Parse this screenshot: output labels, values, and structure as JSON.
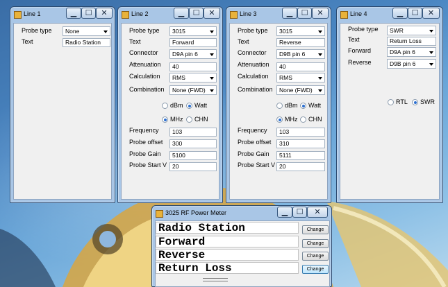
{
  "windows": [
    {
      "title": "Line 1",
      "probe_label": "Probe type",
      "probe_value": "None",
      "text_label": "Text",
      "text_value": "Radio Station"
    },
    {
      "title": "Line 2",
      "probe_label": "Probe type",
      "probe_value": "3015",
      "text_label": "Text",
      "text_value": "Forward",
      "connector_label": "Connector",
      "connector_value": "D9A pin 6",
      "attenuation_label": "Attenuation",
      "attenuation_value": "40",
      "calculation_label": "Calculation",
      "calculation_value": "RMS",
      "combination_label": "Combination",
      "combination_value": "None (FWD)",
      "dbm_label": "dBm",
      "watt_label": "Watt",
      "unit_selected": "Watt",
      "mhz_label": "MHz",
      "chn_label": "CHN",
      "freq_mode_selected": "MHz",
      "frequency_label": "Frequency",
      "frequency_value": "103",
      "probe_offset_label": "Probe offset",
      "probe_offset_value": "300",
      "probe_gain_label": "Probe Gain",
      "probe_gain_value": "5100",
      "probe_start_label": "Probe Start V",
      "probe_start_value": "20"
    },
    {
      "title": "Line 3",
      "probe_label": "Probe type",
      "probe_value": "3015",
      "text_label": "Text",
      "text_value": "Reverse",
      "connector_label": "Connector",
      "connector_value": "D9B pin 6",
      "attenuation_label": "Attenuation",
      "attenuation_value": "40",
      "calculation_label": "Calculation",
      "calculation_value": "RMS",
      "combination_label": "Combination",
      "combination_value": "None (FWD)",
      "dbm_label": "dBm",
      "watt_label": "Watt",
      "unit_selected": "Watt",
      "mhz_label": "MHz",
      "chn_label": "CHN",
      "freq_mode_selected": "MHz",
      "frequency_label": "Frequency",
      "frequency_value": "103",
      "probe_offset_label": "Probe offset",
      "probe_offset_value": "310",
      "probe_gain_label": "Probe Gain",
      "probe_gain_value": "5111",
      "probe_start_label": "Probe Start V",
      "probe_start_value": "20"
    },
    {
      "title": "Line 4",
      "probe_label": "Probe type",
      "probe_value": "SWR",
      "text_label": "Text",
      "text_value": "Return Loss",
      "forward_label": "Forward",
      "forward_value": "D9A pin 6",
      "reverse_label": "Reverse",
      "reverse_value": "D9B pin 6",
      "rtl_label": "RTL",
      "swr_label": "SWR",
      "mode_selected": "SWR"
    }
  ],
  "meter": {
    "title": "3025 RF Power Meter",
    "lines": [
      "Radio Station",
      "Forward",
      "Reverse",
      "Return Loss"
    ],
    "change_label": "Change",
    "highlighted_button": 4
  },
  "window_controls": {
    "minimize": "▁",
    "maximize": "☐",
    "close": "✕"
  },
  "colors": {
    "titlebar": "#a9c6e6",
    "client": "#f0f0f0",
    "radio_selected": "#2c6fd0",
    "title_icon": "#e9b23a"
  }
}
